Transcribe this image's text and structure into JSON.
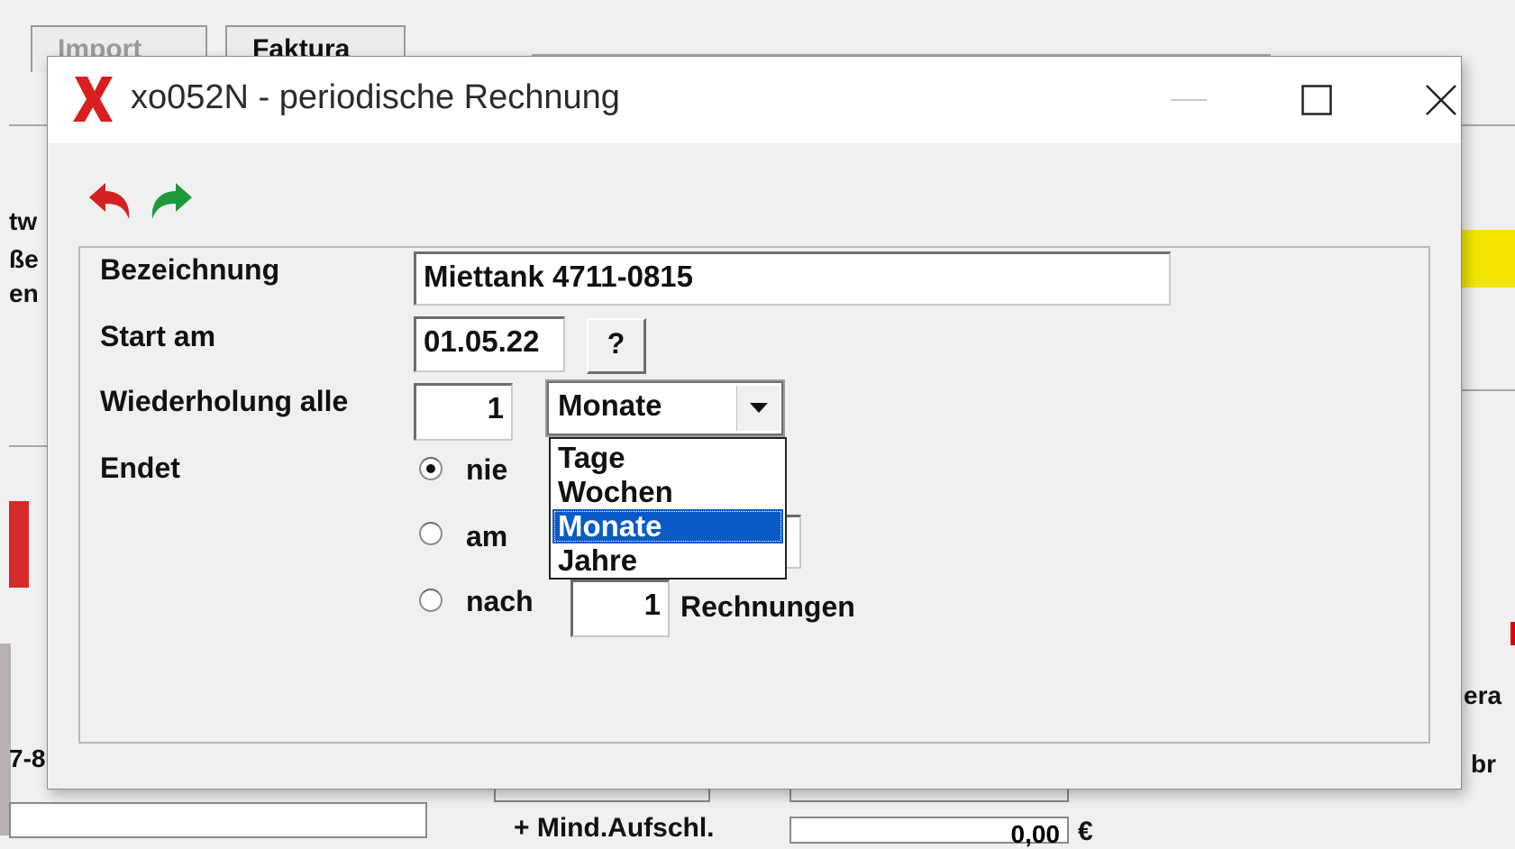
{
  "background_app": {
    "tabs": [
      {
        "label": "Import",
        "active": false
      },
      {
        "label": "Faktura",
        "active": true
      }
    ],
    "fragments": {
      "left_1": "tw",
      "left_2": "ße",
      "left_3": "en",
      "left_4": "7-8",
      "right_1": "era",
      "right_2": "br",
      "bottom_label": "+ Mind.Aufschl.",
      "bottom_value": "0,00",
      "bottom_currency": "€"
    }
  },
  "dialog": {
    "title": "xo052N - periodische Rechnung",
    "controls": {
      "minimize": "minimize",
      "maximize": "maximize",
      "close": "close"
    },
    "toolbar": {
      "undo_icon": "undo-arrow-icon",
      "redo_icon": "redo-arrow-icon",
      "colors": {
        "undo": "#d42020",
        "redo": "#1e9a3a"
      }
    },
    "form": {
      "bezeichnung_label": "Bezeichnung",
      "bezeichnung_value": "Miettank 4711-0815",
      "start_label": "Start am",
      "start_value": "01.05.22",
      "date_picker_label": "?",
      "repeat_label": "Wiederholung alle",
      "repeat_count": "1",
      "interval_selected": "Monate",
      "interval_options": [
        "Tage",
        "Wochen",
        "Monate",
        "Jahre"
      ],
      "ends_label": "Endet",
      "end_options": {
        "never": "nie",
        "on": "am",
        "after": "nach"
      },
      "end_selected": "nie",
      "after_count": "1",
      "after_unit": "Rechnungen"
    }
  },
  "colors": {
    "selection": "#0a5ac8",
    "logo": "#d81e1e",
    "background_yellow": "#f2e400"
  }
}
